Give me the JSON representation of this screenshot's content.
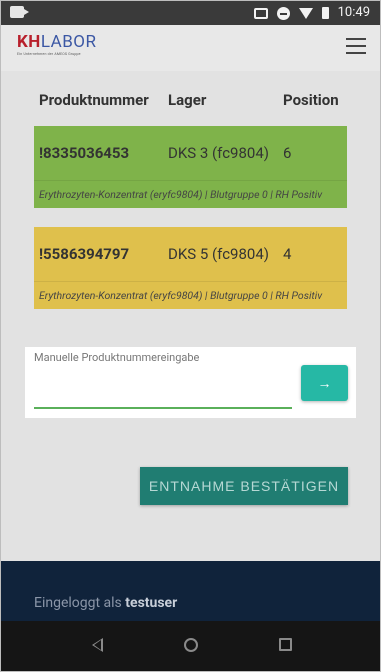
{
  "status_bar": {
    "time": "10:49"
  },
  "app_bar": {
    "logo_kh": "KH",
    "logo_labor": "LABOR",
    "logo_subtitle": "Ein Unternehmen der AMEOS Gruppe"
  },
  "table": {
    "headers": [
      "Produktnummer",
      "Lager",
      "Position"
    ],
    "rows": [
      {
        "produktnummer": "!8335036453",
        "lager": "DKS 3 (fc9804)",
        "position": "6",
        "description": "Erythrozyten-Konzentrat (eryfc9804) | Blutgruppe 0 | RH Positiv",
        "color": "#7fb34a"
      },
      {
        "produktnummer": "!5586394797",
        "lager": "DKS 5 (fc9804)",
        "position": "4",
        "description": "Erythrozyten-Konzentrat (eryfc9804) | Blutgruppe 0 | RH Positiv",
        "color": "#dfc04c"
      }
    ]
  },
  "manual_input": {
    "label": "Manuelle Produktnummereingabe",
    "value": "",
    "submit_label": "→"
  },
  "confirm_button": {
    "label": "ENTNAHME BESTÄTIGEN"
  },
  "footer": {
    "logged_in_prefix": "Eingeloggt als",
    "username": "testuser"
  },
  "colors": {
    "accent": "#26b8a5",
    "primary_dark": "#207d72",
    "footer": "#10233b"
  }
}
